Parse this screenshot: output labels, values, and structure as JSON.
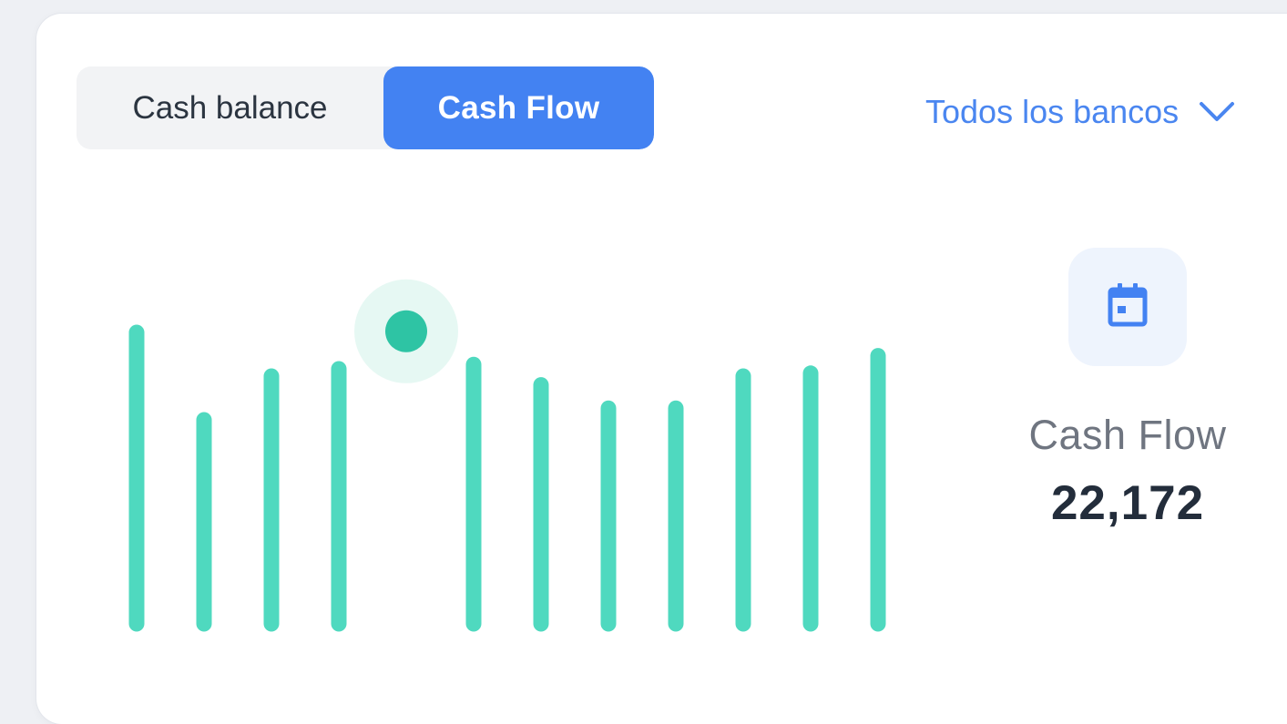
{
  "toggle": {
    "options": [
      {
        "label": "Cash balance",
        "active": false
      },
      {
        "label": "Cash Flow",
        "active": true
      }
    ],
    "active_color": "#4382f2"
  },
  "bank_filter": {
    "label": "Todos los bancos",
    "icon": "chevron-down-icon",
    "color": "#4a86f0"
  },
  "stat": {
    "icon": "calendar-icon",
    "label": "Cash Flow",
    "value": "22,172"
  },
  "chart_data": {
    "type": "bar",
    "bar_color": "#4fd9bf",
    "highlight_color": "#2ec4a4",
    "values": [
      100,
      70,
      85,
      87.5,
      101,
      89,
      82,
      74,
      74,
      85,
      86,
      92
    ],
    "highlighted_index": 4,
    "ylim": [
      0,
      100
    ],
    "grid": false,
    "legend": "none"
  }
}
